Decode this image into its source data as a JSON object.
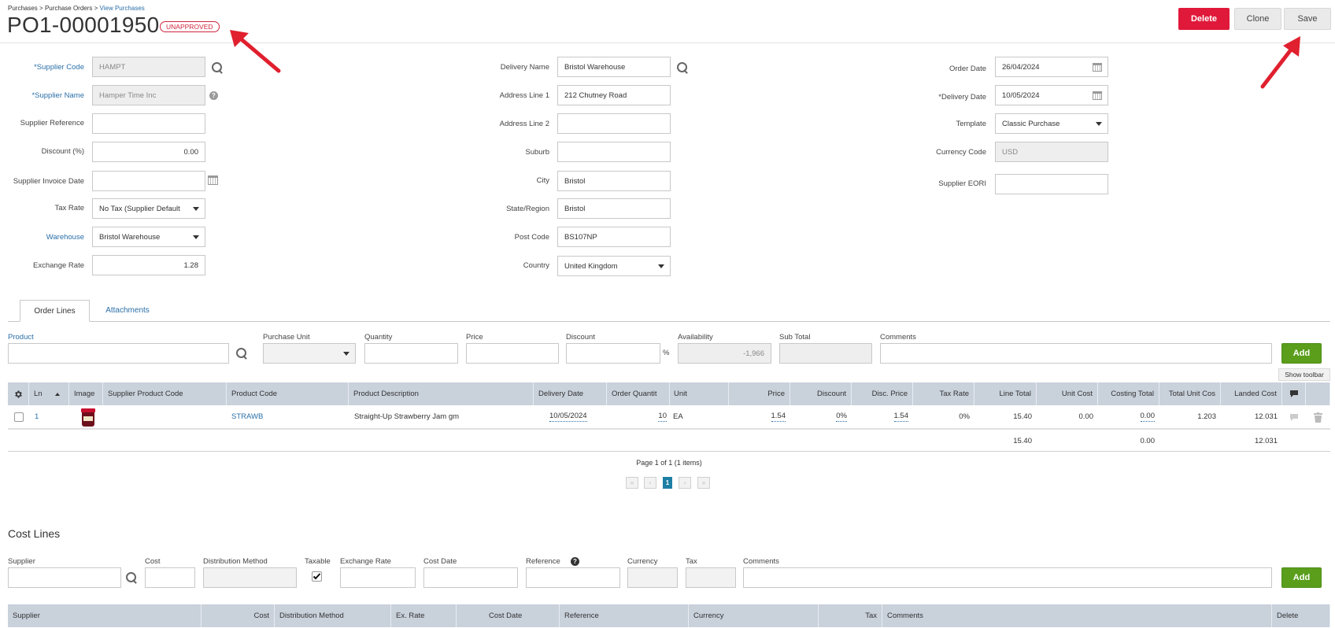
{
  "breadcrumb": {
    "part1": "Purchases",
    "sep": ">",
    "part2": "Purchase Orders",
    "part3": "View Purchases"
  },
  "header": {
    "title": "PO1-00001950",
    "status": "UNAPPROVED"
  },
  "toolbar": {
    "delete_label": "Delete",
    "clone_label": "Clone",
    "save_label": "Save"
  },
  "supplier": {
    "code_label": "*Supplier Code",
    "code_value": "HAMPT",
    "name_label": "*Supplier Name",
    "name_value": "Hamper Time Inc",
    "reference_label": "Supplier Reference",
    "reference_value": "",
    "discount_label": "Discount (%)",
    "discount_value": "0.00",
    "invoice_date_label": "Supplier Invoice Date",
    "invoice_date_value": "",
    "tax_rate_label": "Tax Rate",
    "tax_rate_value": "No Tax (Supplier Default",
    "warehouse_label": "Warehouse",
    "warehouse_value": "Bristol Warehouse",
    "exchange_rate_label": "Exchange Rate",
    "exchange_rate_value": "1.28"
  },
  "delivery": {
    "name_label": "Delivery Name",
    "name_value": "Bristol Warehouse",
    "address1_label": "Address Line 1",
    "address1_value": "212 Chutney Road",
    "address2_label": "Address Line 2",
    "address2_value": "",
    "suburb_label": "Suburb",
    "suburb_value": "",
    "city_label": "City",
    "city_value": "Bristol",
    "state_label": "State/Region",
    "state_value": "Bristol",
    "postcode_label": "Post Code",
    "postcode_value": "BS107NP",
    "country_label": "Country",
    "country_value": "United Kingdom"
  },
  "order": {
    "order_date_label": "Order Date",
    "order_date_value": "26/04/2024",
    "delivery_date_label": "*Delivery Date",
    "delivery_date_value": "10/05/2024",
    "template_label": "Template",
    "template_value": "Classic Purchase",
    "currency_label": "Currency Code",
    "currency_value": "USD",
    "eori_label": "Supplier EORI",
    "eori_value": ""
  },
  "tabs": {
    "order_lines": "Order Lines",
    "attachments": "Attachments"
  },
  "entry": {
    "product": "Product",
    "purchase_unit": "Purchase Unit",
    "quantity": "Quantity",
    "price": "Price",
    "discount": "Discount",
    "percent": "%",
    "availability": "Availability",
    "availability_value": "-1,966",
    "sub_total": "Sub Total",
    "comments": "Comments",
    "add": "Add"
  },
  "tooltip": "Show toolbar",
  "grid": {
    "headers": {
      "ln": "Ln",
      "image": "Image",
      "supplier_product_code": "Supplier Product Code",
      "product_code": "Product Code",
      "product_description": "Product Description",
      "delivery_date": "Delivery Date",
      "order_quantity": "Order Quantit",
      "unit": "Unit",
      "price": "Price",
      "discount": "Discount",
      "disc_price": "Disc. Price",
      "tax_rate": "Tax Rate",
      "line_total": "Line Total",
      "unit_cost": "Unit Cost",
      "costing_total": "Costing Total",
      "total_unit_cost": "Total Unit Cos",
      "landed_cost": "Landed Cost"
    },
    "rows": [
      {
        "ln": "1",
        "supplier_product_code": "",
        "product_code": "STRAWB",
        "product_description": "Straight-Up Strawberry Jam gm",
        "delivery_date": "10/05/2024",
        "order_quantity": "10",
        "unit": "EA",
        "price": "1.54",
        "discount": "0%",
        "disc_price": "1.54",
        "tax_rate": "0%",
        "line_total": "15.40",
        "unit_cost": "0.00",
        "costing_total": "0.00",
        "total_unit_cost": "1.203",
        "landed_cost": "12.031"
      }
    ],
    "totals": {
      "line_total": "15.40",
      "costing_total": "0.00",
      "landed_cost": "12.031"
    },
    "pager_text": "Page 1 of 1 (1 items)",
    "pager_current": "1",
    "pager_first": "«",
    "pager_prev": "‹",
    "pager_next": "›",
    "pager_last": "»"
  },
  "cost_lines": {
    "title": "Cost Lines",
    "labels": {
      "supplier": "Supplier",
      "cost": "Cost",
      "distribution_method": "Distribution Method",
      "taxable": "Taxable",
      "exchange_rate": "Exchange Rate",
      "cost_date": "Cost Date",
      "reference": "Reference",
      "currency": "Currency",
      "tax": "Tax",
      "comments": "Comments",
      "add": "Add"
    },
    "headers": {
      "supplier": "Supplier",
      "cost": "Cost",
      "distribution_method": "Distribution Method",
      "ex_rate": "Ex. Rate",
      "cost_date": "Cost Date",
      "reference": "Reference",
      "currency": "Currency",
      "tax": "Tax",
      "comments": "Comments",
      "delete": "Delete"
    }
  },
  "colors": {
    "accent": "#2a6fa8",
    "danger": "#e0193a",
    "success": "#5a9e1b",
    "grid_header": "#c9d1db",
    "pager": "#1d7fa3"
  }
}
